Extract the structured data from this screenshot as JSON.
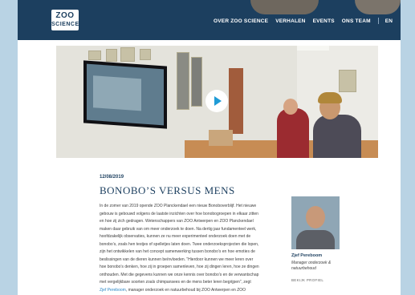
{
  "logo": {
    "line1": "ZOO",
    "line2": "SCIENCE"
  },
  "nav": {
    "items": [
      "OVER ZOO SCIENCE",
      "VERHALEN",
      "EVENTS",
      "ONS TEAM"
    ],
    "lang": "EN"
  },
  "article": {
    "date": "12/08/2019",
    "title": "BONOBO’S VERSUS MENS",
    "body_lines": [
      "In de zomer van 2019 opende ZOO Planckendael een nieuw Bonoboverblijf. Het nieuwe",
      "gebouw is gebouwd volgens de laatste inzichten over hoe bonobogroepen in elkaar zitten",
      "en hoe zij zich gedragen. Wetenschappers van ZOO Antwerpen en ZOO Planckendael",
      "maken daar gebruik van om meer onderzoek te doen. Na dertig jaar fundamenteel werk,",
      "hoofdzakelijk observaties, kunnen ze nu meer experimenteel onderzoek doen met de",
      "bonobo’s, zoals hen testjes of spelletjes laten doen. Twee onderzoeksprojecten die lopen,",
      "zijn het ontwikkelen van het concept samenwerking tussen bonobo’s en hoe emoties de",
      "beslissingen van de dieren kunnen beïnvloeden. “Hierdoor kunnen we meer leren over",
      "hoe bonobo’s denken, hoe zij in groepen samenleven, hoe zij dingen leren, hoe ze dingen",
      "onthouden. Met die gegevens kunnen we onze kennis over bonobo’s en de verwantschap",
      "met vergelijkbare soorten zoals chimpansees en de mens beter leren begrijpen”, zegt"
    ],
    "last_line_link": "Zjef Pereboom",
    "last_line_rest": ", manager onderzoek en natuurbehoud bij ZOO Antwerpen en ZOO"
  },
  "author": {
    "name": "Zjef Pereboom",
    "role": "Manager onderzoek & natuurbehoud",
    "link": "BEKIJK PROFIEL"
  },
  "colors": {
    "header": "#1c3f5f",
    "accent": "#1f9bd6",
    "background": "#cfe2ee"
  }
}
